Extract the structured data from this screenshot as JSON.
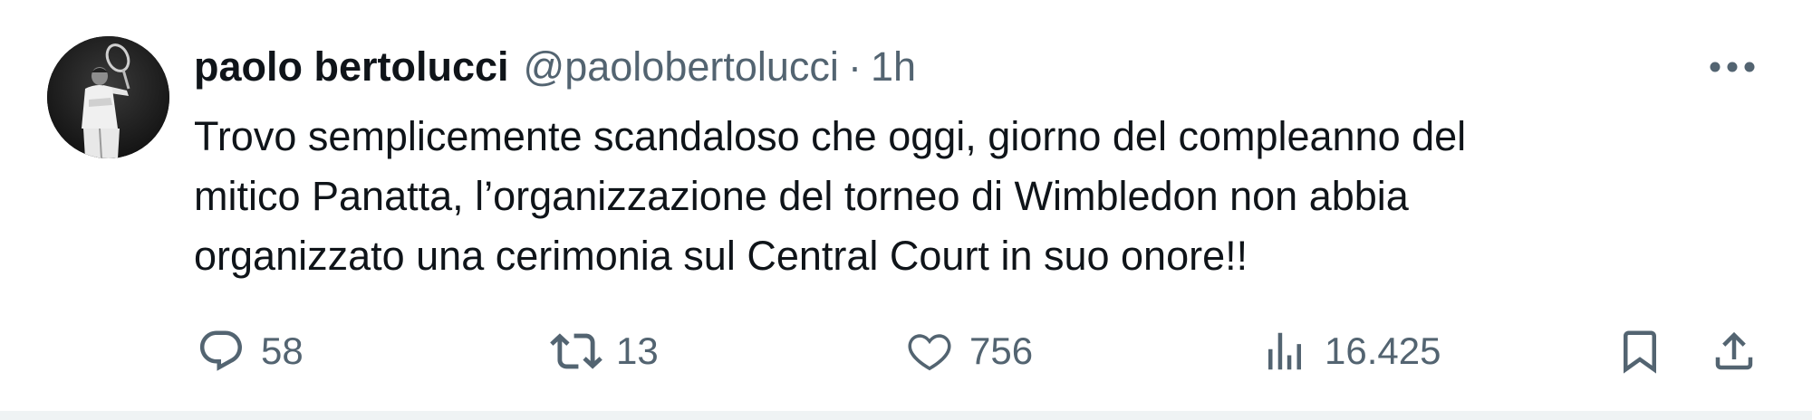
{
  "tweet": {
    "author": {
      "display_name": "paolo bertolucci",
      "handle": "@paolobertolucci"
    },
    "separator": "·",
    "time": "1h",
    "text": "Trovo semplicemente scandaloso che oggi, giorno del compleanno del\nmitico Panatta, l’organizzazione del torneo di Wimbledon non abbia\norganizzato una cerimonia sul Central Court in suo onore!!"
  },
  "actions": {
    "replies": "58",
    "reposts": "13",
    "likes": "756",
    "views": "16.425"
  },
  "icons": {
    "more": "more-horizontal-icon",
    "reply": "reply-bubble-icon",
    "repost": "repost-arrows-icon",
    "like": "heart-icon",
    "views": "views-bar-chart-icon",
    "bookmark": "bookmark-icon",
    "share": "share-upload-icon"
  },
  "colors": {
    "text_primary": "#0f1419",
    "text_secondary": "#536471",
    "background": "#ffffff",
    "divider": "#eff3f4"
  }
}
